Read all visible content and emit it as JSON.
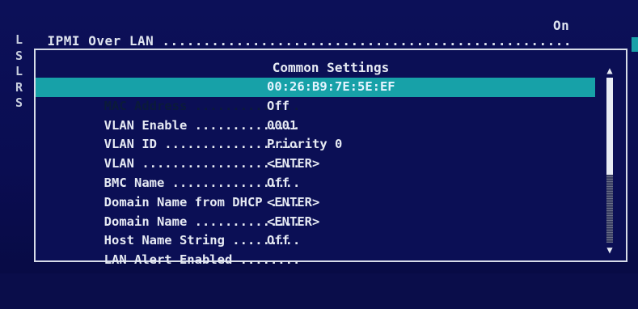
{
  "top_line": {
    "label": "IPMI Over LAN ..................................................",
    "value": "On"
  },
  "left_letters": [
    "L",
    "S",
    "L",
    "R",
    "S"
  ],
  "panel": {
    "title": "Common Settings",
    "rows": [
      {
        "field": "MAC Address ..............",
        "value": "00:26:B9:7E:5E:EF"
      },
      {
        "field": "VLAN Enable ..............",
        "value": "Off"
      },
      {
        "field": "VLAN ID ..................",
        "value": "0001"
      },
      {
        "field": "VLAN .....................",
        "value": "Priority 0"
      },
      {
        "field": "BMC Name .................",
        "value": "<ENTER>"
      },
      {
        "field": "Domain Name from DHCP ....",
        "value": "Off"
      },
      {
        "field": "Domain Name ..............",
        "value": "<ENTER>"
      },
      {
        "field": "Host Name String .........",
        "value": "<ENTER>"
      },
      {
        "field": "LAN Alert Enabled ........",
        "value": "Off"
      }
    ]
  },
  "scrollbar": {
    "up_arrow": "▲",
    "down_arrow": "▼"
  },
  "colors": {
    "background": "#0a0d4a",
    "highlight": "#17a1a8",
    "text": "#e6eaf3"
  }
}
